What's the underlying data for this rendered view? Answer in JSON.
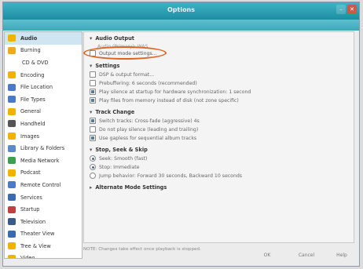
{
  "window": {
    "title": "Options"
  },
  "sidebar": {
    "items": [
      {
        "label": "Audio",
        "icon": "audio-icon",
        "color": "#f0b400"
      },
      {
        "label": "Burning",
        "icon": "burning-icon",
        "color": "#f0a820"
      },
      {
        "label": "CD & DVD",
        "icon": "cd-dvd-icon",
        "color": "#ffffff"
      },
      {
        "label": "Encoding",
        "icon": "encoding-icon",
        "color": "#f0b400"
      },
      {
        "label": "File Location",
        "icon": "file-location-icon",
        "color": "#4a7ac8"
      },
      {
        "label": "File Types",
        "icon": "file-types-icon",
        "color": "#4a7ac8"
      },
      {
        "label": "General",
        "icon": "general-icon",
        "color": "#f0b400"
      },
      {
        "label": "Handheld",
        "icon": "handheld-icon",
        "color": "#555555"
      },
      {
        "label": "Images",
        "icon": "images-icon",
        "color": "#f0b400"
      },
      {
        "label": "Library & Folders",
        "icon": "library-folders-icon",
        "color": "#5a8ac8"
      },
      {
        "label": "Media Network",
        "icon": "media-network-icon",
        "color": "#3aa050"
      },
      {
        "label": "Podcast",
        "icon": "podcast-icon",
        "color": "#f0b400"
      },
      {
        "label": "Remote Control",
        "icon": "remote-control-icon",
        "color": "#4a7ac8"
      },
      {
        "label": "Services",
        "icon": "services-icon",
        "color": "#3a6ab0"
      },
      {
        "label": "Startup",
        "icon": "startup-icon",
        "color": "#c04040"
      },
      {
        "label": "Television",
        "icon": "television-icon",
        "color": "#3a5a8a"
      },
      {
        "label": "Theater View",
        "icon": "theater-view-icon",
        "color": "#3a6ab0"
      },
      {
        "label": "Tree & View",
        "icon": "tree-view-icon",
        "color": "#f0b400"
      },
      {
        "label": "Video",
        "icon": "video-icon",
        "color": "#f0b400"
      }
    ]
  },
  "content": {
    "audio_output": {
      "header": "Audio Output",
      "subheader": "Audio (Primary): WAS",
      "output_mode": "Output mode settings..."
    },
    "settings": {
      "header": "Settings",
      "items": [
        {
          "label": "DSP & output format...",
          "checked": false
        },
        {
          "label": "Prebuffering: 6 seconds (recommended)",
          "checked": false
        },
        {
          "label": "Play silence at startup for hardware synchronization: 1 second",
          "checked": true
        },
        {
          "label": "Play files from memory instead of disk (not zone specific)",
          "checked": true
        }
      ]
    },
    "track_change": {
      "header": "Track Change",
      "items": [
        {
          "label": "Switch tracks: Cross-fade (aggressive) 4s",
          "checked": true
        },
        {
          "label": "Do not play silence (leading and trailing)",
          "checked": false
        },
        {
          "label": "Use gapless for sequential album tracks",
          "checked": true
        }
      ]
    },
    "stop_seek_skip": {
      "header": "Stop, Seek & Skip",
      "items": [
        {
          "label": "Seek: Smooth (fast)",
          "checked": true
        },
        {
          "label": "Stop: Immediate",
          "checked": true
        },
        {
          "label": "Jump behavior: Forward 30 seconds, Backward 10 seconds",
          "checked": false
        }
      ]
    },
    "alternate_mode": {
      "header": "Alternate Mode Settings"
    }
  },
  "footer": {
    "note": "NOTE: Changes take effect once playback is stopped.",
    "ok": "OK",
    "cancel": "Cancel",
    "help": "Help"
  },
  "colors": {
    "highlight": "#e0641f",
    "titlebar": "#2a9cb0"
  }
}
